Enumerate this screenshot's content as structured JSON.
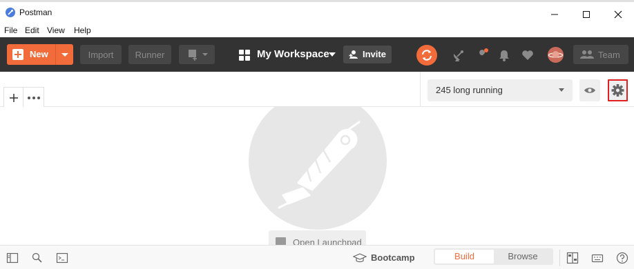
{
  "window": {
    "title": "Postman",
    "controls": {
      "minimize": "—",
      "maximize": "☐",
      "close": "✕"
    }
  },
  "menu": [
    "File",
    "Edit",
    "View",
    "Help"
  ],
  "header": {
    "new_label": "New",
    "import_label": "Import",
    "runner_label": "Runner",
    "workspace_label": "My Workspace",
    "invite_label": "Invite",
    "team_label": "Team",
    "icons": [
      "sync-icon",
      "satellite-icon",
      "settings-wrench-icon",
      "bell-icon",
      "heart-icon",
      "avatar",
      "team-icon"
    ]
  },
  "tabs": {
    "add_label": "+",
    "more_label": "•••"
  },
  "environment": {
    "selected": "245 long running"
  },
  "main": {
    "launchpad_label": "Open Launchpad"
  },
  "statusbar": {
    "bootcamp_label": "Bootcamp",
    "build_label": "Build",
    "browse_label": "Browse"
  },
  "colors": {
    "accent": "#f26b3a",
    "header_bg": "#333333",
    "highlight_border": "#e02020"
  }
}
